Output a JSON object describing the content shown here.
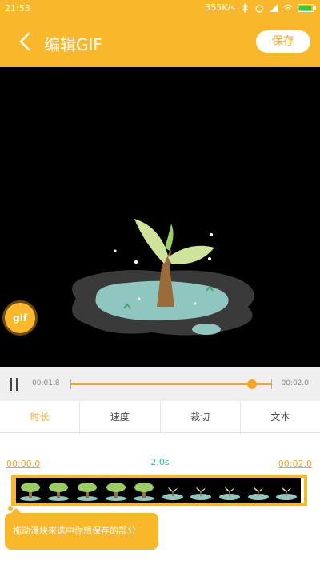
{
  "status": {
    "time": "21:53",
    "speed": "355K/s"
  },
  "header": {
    "title": "编辑GIF",
    "save_label": "保存"
  },
  "preview": {
    "fab_label": "gif"
  },
  "playback": {
    "start_time": "00:01.8",
    "end_time": "00:02.0",
    "progress": 0.9
  },
  "tabs": [
    {
      "label": "时长",
      "active": true
    },
    {
      "label": "速度",
      "active": false
    },
    {
      "label": "裁切",
      "active": false
    },
    {
      "label": "文本",
      "active": false
    }
  ],
  "trim": {
    "start_label": "00:00.0",
    "end_label": "00:02.0",
    "duration": "2.0s",
    "frames": [
      {
        "type": "tree"
      },
      {
        "type": "tree"
      },
      {
        "type": "tree"
      },
      {
        "type": "tree"
      },
      {
        "type": "tree"
      },
      {
        "type": "sprout"
      },
      {
        "type": "sprout"
      },
      {
        "type": "sprout"
      },
      {
        "type": "sprout"
      },
      {
        "type": "sprout"
      }
    ],
    "tip": "拖动滑块来选中你想保存的部分"
  },
  "colors": {
    "accent": "#F9B72B",
    "accent_text": "#F5A623",
    "duration": "#2fbf8f"
  }
}
